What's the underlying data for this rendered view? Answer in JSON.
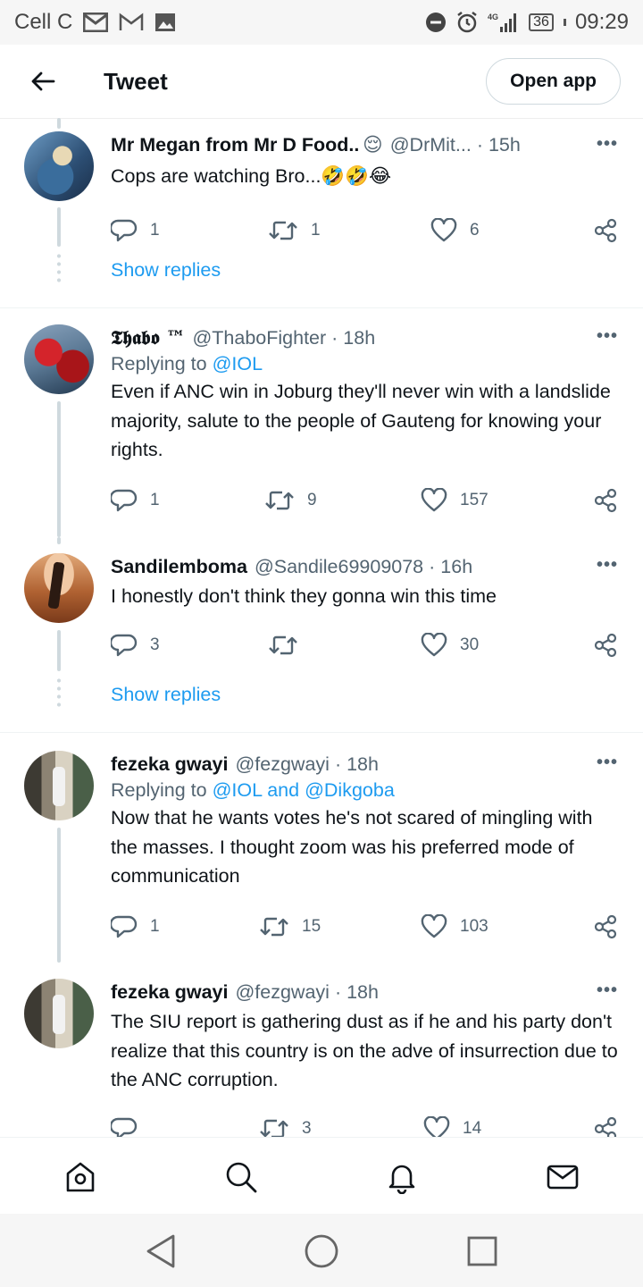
{
  "status_bar": {
    "carrier": "Cell C",
    "network": "4G",
    "battery": "36",
    "time": "09:29"
  },
  "header": {
    "title": "Tweet",
    "open_app_label": "Open app"
  },
  "tweets": [
    {
      "name": "Mr Megan from Mr D Food..",
      "name_emoji": "😌",
      "handle": "@DrMit...",
      "time": "· 15h",
      "replying_to_prefix": "",
      "replying_to_mentions": "",
      "text": "Cops are watching Bro...🤣🤣😂",
      "replies": "1",
      "retweets": "1",
      "likes": "6"
    },
    {
      "name": "𝕿𝖍𝖆𝖇𝖔 ™",
      "handle": "@ThaboFighter",
      "time": "· 18h",
      "replying_to_prefix": "Replying to",
      "replying_to_mentions": "@IOL",
      "text": "Even if ANC win in Joburg they'll never win with a landslide majority, salute to the people of Gauteng for knowing your rights.",
      "replies": "1",
      "retweets": "9",
      "likes": "157"
    },
    {
      "name": "Sandilemboma",
      "handle": "@Sandile69909078",
      "time": "· 16h",
      "replying_to_prefix": "",
      "replying_to_mentions": "",
      "text": "I honestly don't think they gonna win this time",
      "replies": "3",
      "retweets": "",
      "likes": "30"
    },
    {
      "name": "fezeka gwayi",
      "handle": "@fezgwayi",
      "time": "· 18h",
      "replying_to_prefix": "Replying to",
      "replying_to_mentions": "@IOL and @Dikgoba",
      "text": "Now that he wants votes he's not scared of mingling with the masses. I thought zoom was his preferred mode of communication",
      "replies": "1",
      "retweets": "15",
      "likes": "103"
    },
    {
      "name": "fezeka gwayi",
      "handle": "@fezgwayi",
      "time": "· 18h",
      "replying_to_prefix": "",
      "replying_to_mentions": "",
      "text": "The SIU report is gathering dust as if he and his party don't realize that this country is on the adve of insurrection due to the ANC corruption.",
      "replies": "",
      "retweets": "3",
      "likes": "14"
    }
  ],
  "show_replies_label": "Show replies",
  "more_label": "•••",
  "bottom_nav": [
    "home-icon",
    "search-icon",
    "notifications-icon",
    "messages-icon"
  ],
  "colors": {
    "accent": "#1d9bf0",
    "text": "#0f1419",
    "secondary": "#536471"
  }
}
